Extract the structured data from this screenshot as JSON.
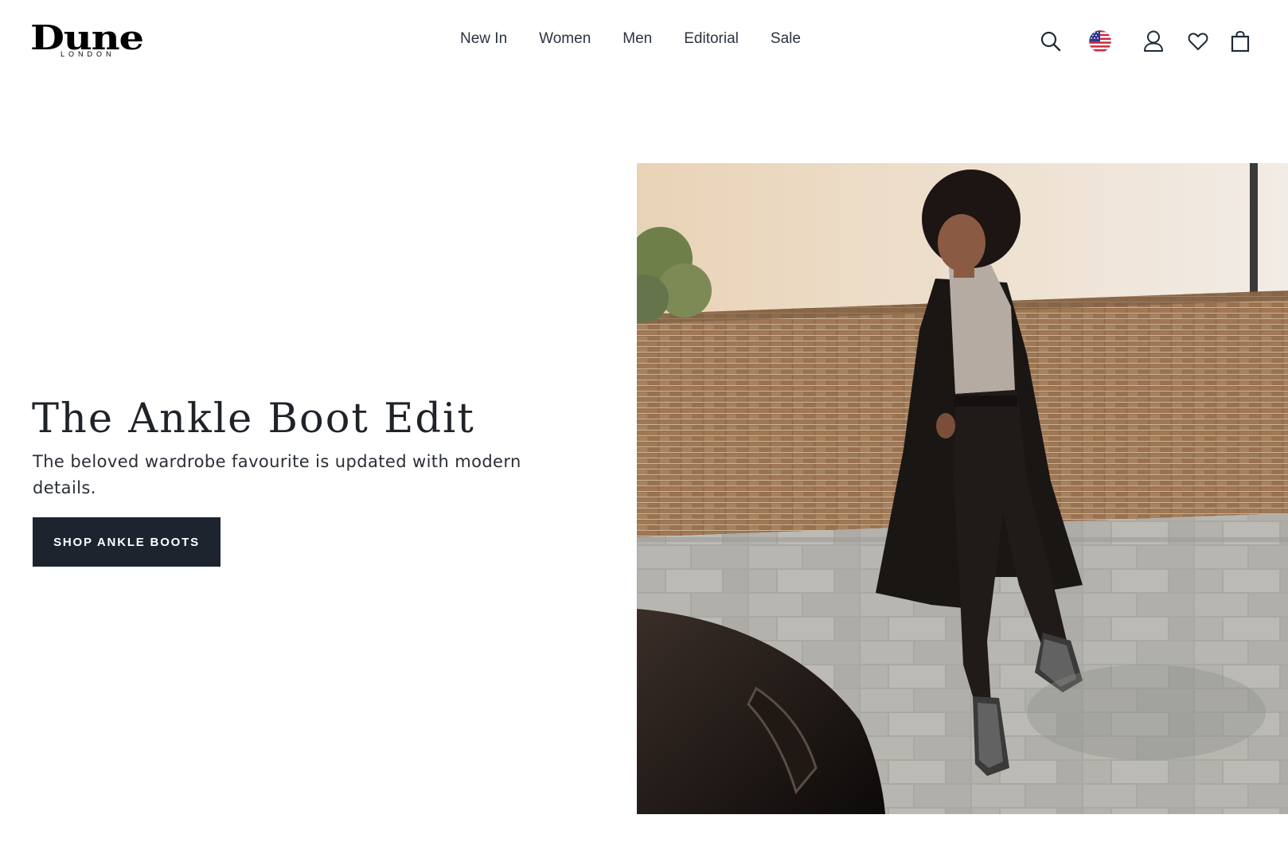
{
  "brand": {
    "name": "Dune",
    "subtitle": "LONDON"
  },
  "nav": {
    "items": [
      {
        "label": "New In"
      },
      {
        "label": "Women"
      },
      {
        "label": "Men"
      },
      {
        "label": "Editorial"
      },
      {
        "label": "Sale"
      }
    ]
  },
  "utilities": {
    "icons": [
      "search-icon",
      "us-flag-icon",
      "account-icon",
      "wishlist-heart-icon",
      "shopping-bag-icon"
    ]
  },
  "hero": {
    "title": "The Ankle Boot Edit",
    "subtitle": "The beloved wardrobe favourite is updated with modern details.",
    "cta_label": "SHOP ANKLE BOOTS"
  },
  "colors": {
    "cta_background": "#1d2430",
    "text": "#1f2a36",
    "background": "#ffffff"
  }
}
